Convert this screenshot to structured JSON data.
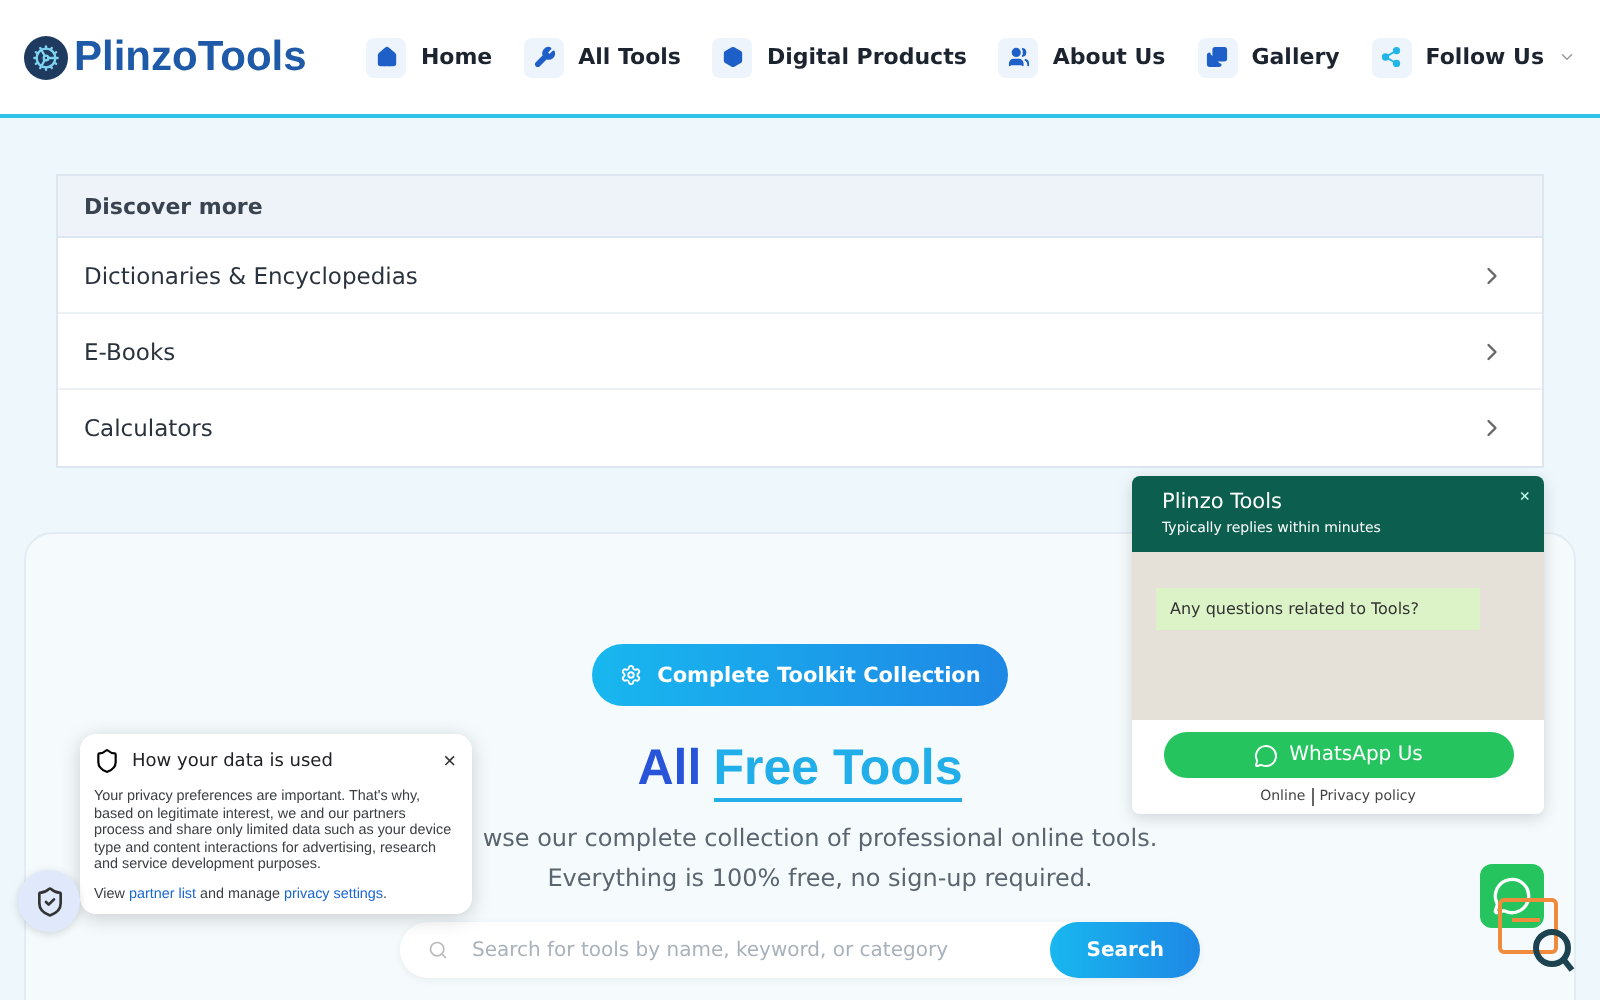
{
  "header": {
    "logo": {
      "first": "Plinzo",
      "second": "Tools"
    },
    "nav": [
      {
        "label": "Home",
        "dropdown": false
      },
      {
        "label": "All Tools",
        "dropdown": false
      },
      {
        "label": "Digital Products",
        "dropdown": false
      },
      {
        "label": "About Us",
        "dropdown": false
      },
      {
        "label": "Gallery",
        "dropdown": false
      },
      {
        "label": "Follow Us",
        "dropdown": true
      }
    ]
  },
  "discover": {
    "title": "Discover more",
    "items": [
      "Dictionaries & Encyclopedias",
      "E-Books",
      "Calculators"
    ]
  },
  "hero": {
    "badge": "Complete Toolkit Collection",
    "title_first": "All",
    "title_second": "Free Tools",
    "subtitle_lines": [
      "wse our complete collection of professional online tools.",
      "Everything is 100% free, no sign-up required."
    ],
    "search": {
      "placeholder": "Search for tools by name, keyword, or category",
      "button": "Search"
    }
  },
  "privacy_popup": {
    "title": "How your data is used",
    "close": "×",
    "body": "Your privacy preferences are important. That's why, based on legitimate interest, we and our partners process and share only limited data such as your device type and content interactions for advertising, research and service development purposes.",
    "footer": [
      {
        "kind": "text",
        "text": "View "
      },
      {
        "kind": "link",
        "text": "partner list"
      },
      {
        "kind": "text",
        "text": " and manage "
      },
      {
        "kind": "link",
        "text": "privacy settings"
      },
      {
        "kind": "text",
        "text": "."
      }
    ]
  },
  "chat_widget": {
    "title": "Plinzo Tools",
    "subtitle": "Typically replies within minutes",
    "close": "×",
    "message": "Any questions related to Tools?",
    "button": "WhatsApp Us",
    "footer": [
      "Online",
      "Privacy policy"
    ]
  }
}
